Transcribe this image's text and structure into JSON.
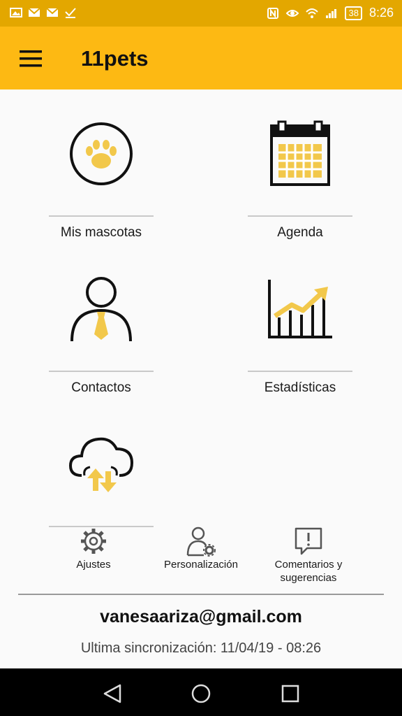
{
  "status_bar": {
    "battery": "38",
    "time": "8:26",
    "icons": [
      "gallery-icon",
      "mail-icon",
      "mail-icon",
      "checkmark-icon",
      "nfc-icon",
      "eye-icon",
      "wifi-icon",
      "signal-icon",
      "battery-icon"
    ]
  },
  "app_bar": {
    "title": "11pets",
    "menu_icon": "hamburger-menu-icon"
  },
  "tiles": [
    {
      "label": "Mis mascotas",
      "icon": "paw-icon"
    },
    {
      "label": "Agenda",
      "icon": "calendar-icon"
    },
    {
      "label": "Contactos",
      "icon": "contact-person-icon"
    },
    {
      "label": "Estadísticas",
      "icon": "statistics-chart-icon"
    },
    {
      "label": "",
      "icon": "cloud-sync-icon"
    }
  ],
  "bottom_actions": [
    {
      "label": "Ajustes",
      "icon": "gear-icon"
    },
    {
      "label": "Personalización",
      "icon": "user-settings-icon"
    },
    {
      "label": "Comentarios y sugerencias",
      "icon": "feedback-icon"
    }
  ],
  "account": {
    "email": "vanesaariza@gmail.com",
    "sync_text": "Ultima sincronización: 11/04/19 - 08:26"
  },
  "nav_bar": {
    "icons": [
      "back-icon",
      "home-icon",
      "recents-icon"
    ]
  },
  "colors": {
    "accent": "#fdb913",
    "status_bar": "#e3a700",
    "icon_yellow": "#f2c84b",
    "icon_stroke": "#111111"
  }
}
